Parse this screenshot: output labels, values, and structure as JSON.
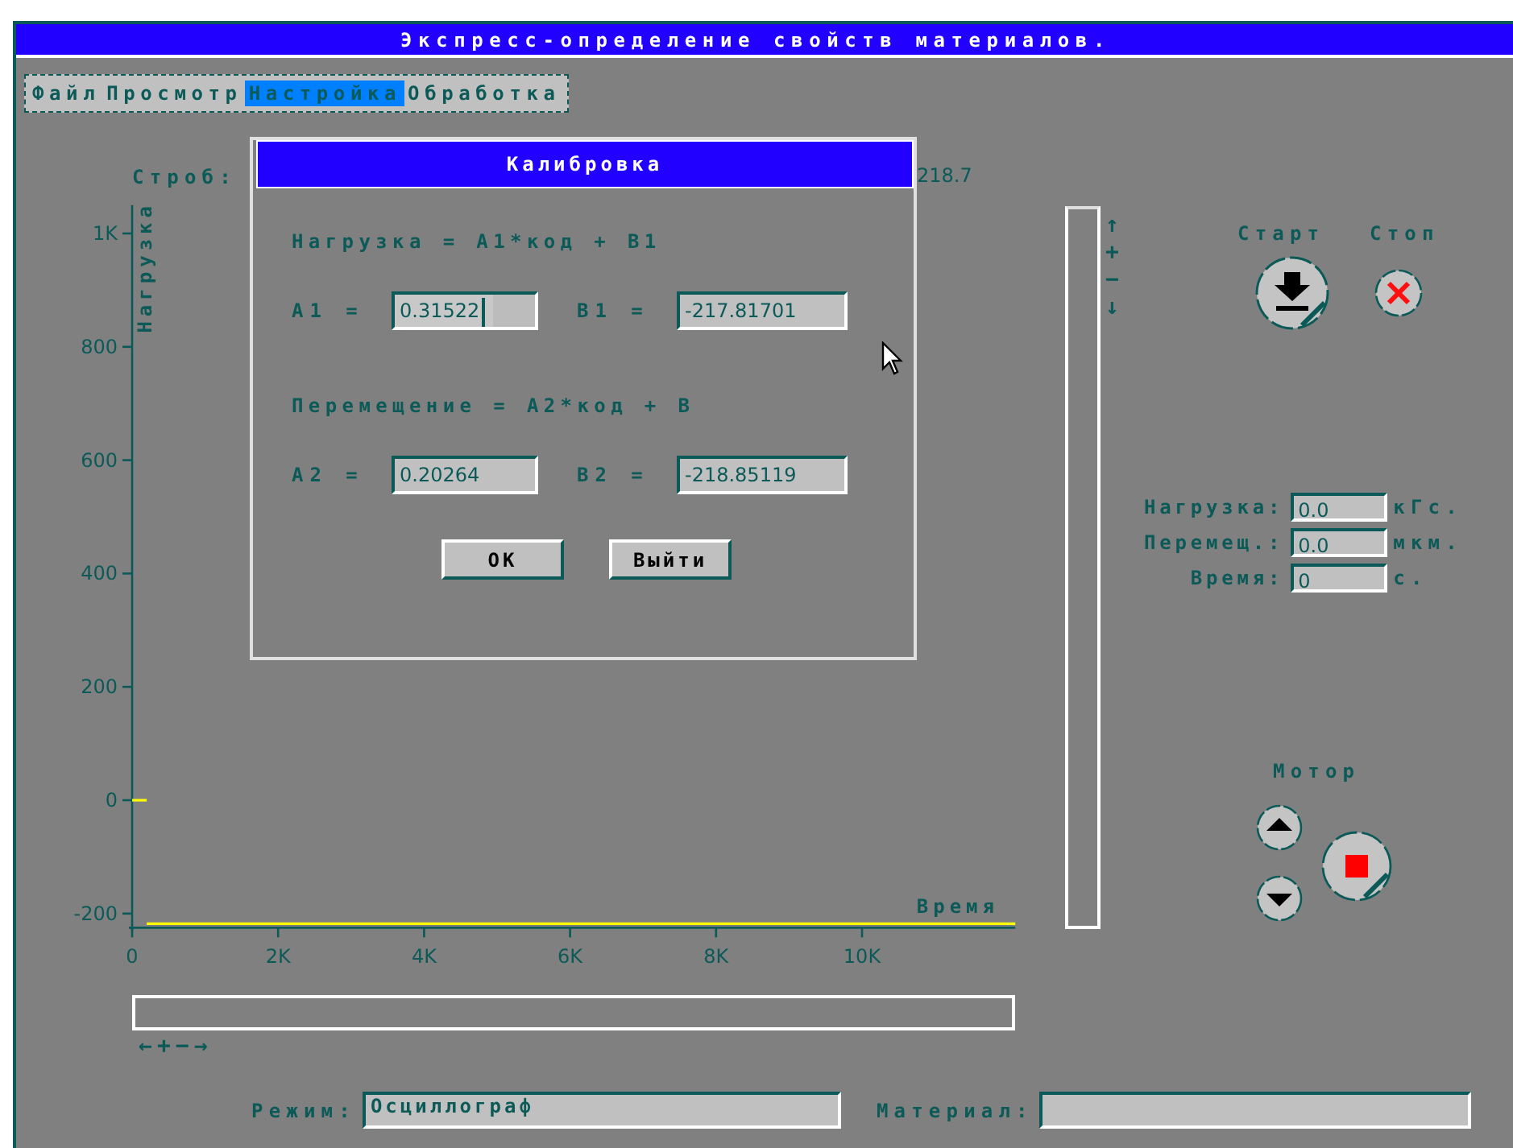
{
  "window": {
    "title": "Экспресс-определение свойств материалов."
  },
  "menu": [
    {
      "label": "Файл",
      "selected": false
    },
    {
      "label": "Просмотр",
      "selected": false
    },
    {
      "label": "Настройка",
      "selected": true
    },
    {
      "label": "Обработка",
      "selected": false
    }
  ],
  "strobe": {
    "label": "Строб:",
    "value": "218.7"
  },
  "chart": {
    "chart_data": {
      "type": "line",
      "xlabel": "Время",
      "ylabel": "Нагрузка",
      "x": [
        0,
        200,
        12100
      ],
      "series": [
        {
          "color": "#ffff00",
          "values": [
            0,
            0,
            null
          ]
        },
        {
          "color": "#ffff00",
          "values": [
            null,
            -218,
            -218
          ]
        }
      ],
      "xlim": [
        0,
        12100
      ],
      "ylim": [
        -225,
        1050
      ],
      "xticks": [
        0,
        {
          "value": 2000,
          "label": "2K"
        },
        {
          "value": 4000,
          "label": "4K"
        },
        {
          "value": 6000,
          "label": "6K"
        },
        {
          "value": 8000,
          "label": "8K"
        },
        {
          "value": 10000,
          "label": "10K"
        }
      ],
      "yticks": [
        -200,
        0,
        200,
        400,
        600,
        800,
        {
          "value": 1000,
          "label": "1K"
        }
      ]
    }
  },
  "vertical_zoom": [
    "↑",
    "+",
    "−",
    "↓"
  ],
  "horizontal_zoom": [
    "←",
    "+",
    "−",
    "→"
  ],
  "start": {
    "label": "Старт"
  },
  "stop": {
    "label": "Стоп"
  },
  "readouts": [
    {
      "label": "Нагрузка:",
      "value": "0.0",
      "unit": "кГс."
    },
    {
      "label": "Перемещ.:",
      "value": "0.0",
      "unit": "мкм."
    },
    {
      "label": "Время:",
      "value": "0",
      "unit": "с."
    }
  ],
  "motor": {
    "label": "Мотор"
  },
  "mode": {
    "label": "Режим:",
    "value": "Осциллограф"
  },
  "material": {
    "label": "Материал:"
  },
  "dialog": {
    "title": "Калибровка",
    "groups": [
      {
        "formula": "Нагрузка = A1*код + B1",
        "fields": [
          {
            "label": "A1 =",
            "value": "0.31522",
            "focused": true
          },
          {
            "label": "B1 =",
            "value": "-217.81701",
            "focused": false
          }
        ]
      },
      {
        "formula": "Перемещение = A2*код + B",
        "fields": [
          {
            "label": "A2 =",
            "value": "0.20264",
            "focused": false
          },
          {
            "label": "B2 =",
            "value": "-218.85119",
            "focused": false
          }
        ]
      }
    ],
    "buttons": [
      "OK",
      "Выйти"
    ]
  }
}
